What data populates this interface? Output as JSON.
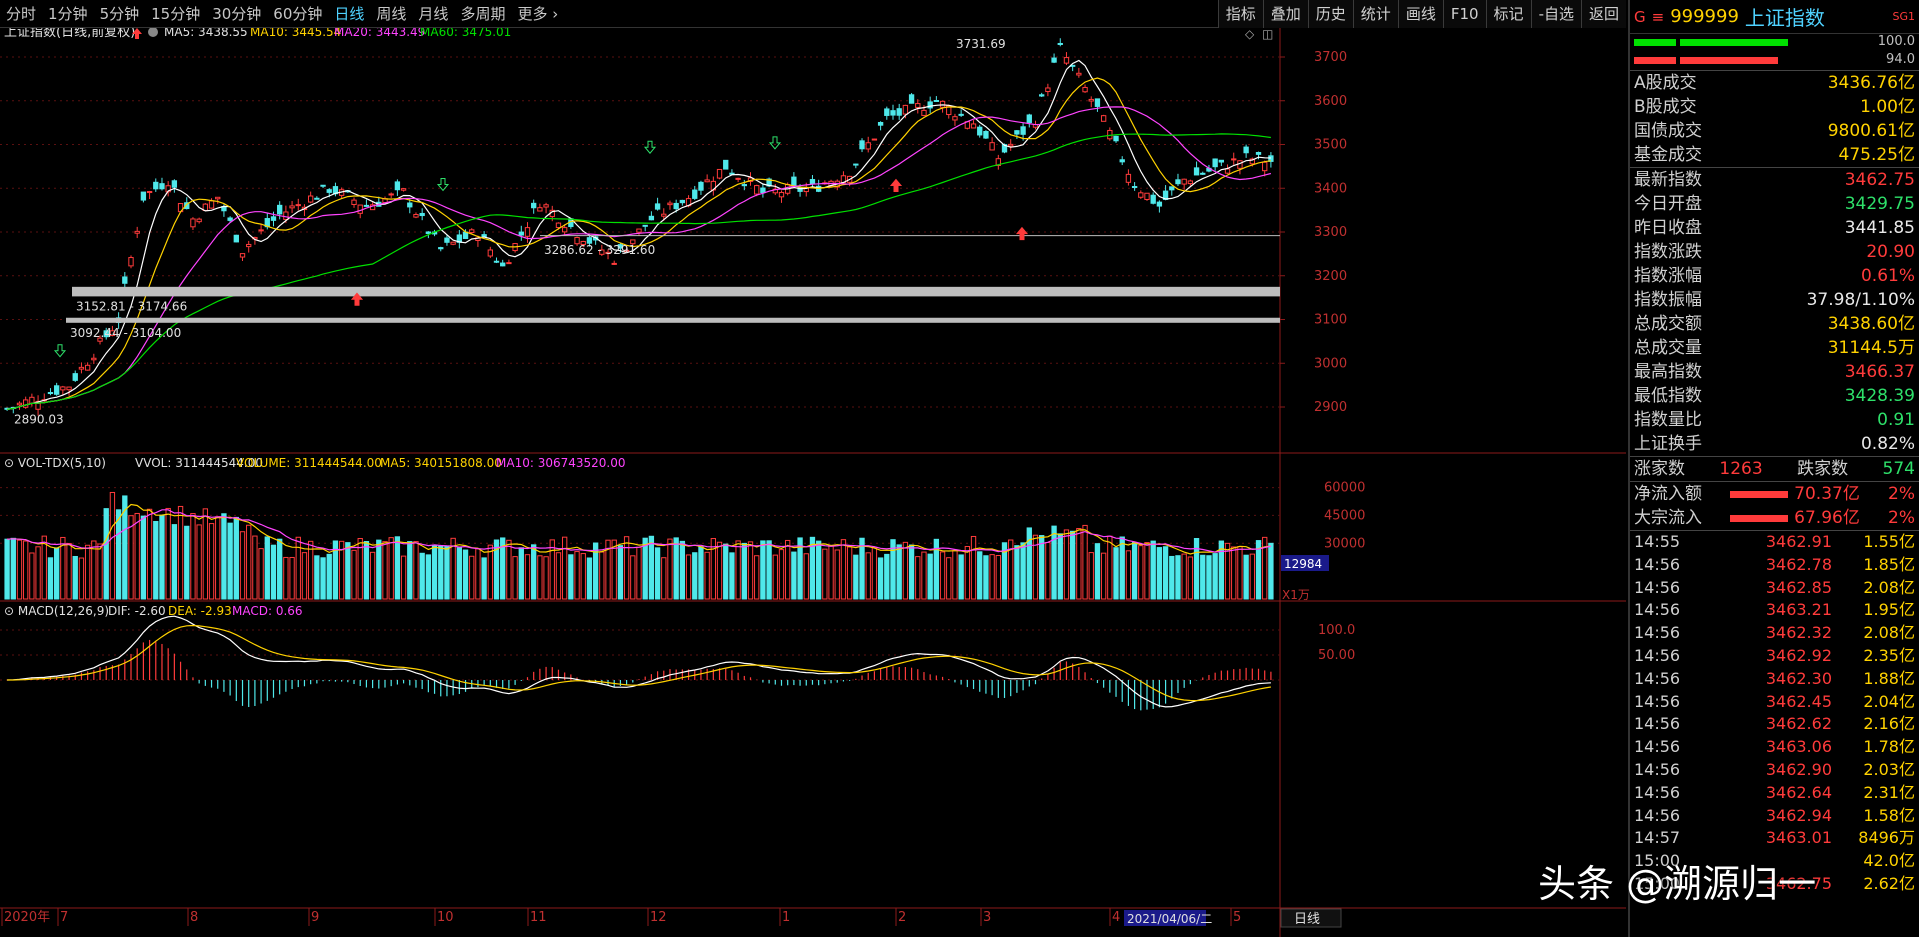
{
  "toolbar": {
    "periods": [
      "分时",
      "1分钟",
      "5分钟",
      "15分钟",
      "30分钟",
      "60分钟",
      "日线",
      "周线",
      "月线",
      "多周期",
      "更多"
    ],
    "active_period": "日线",
    "right_buttons": [
      "指标",
      "叠加",
      "历史",
      "统计",
      "画线",
      "F10",
      "标记",
      "-自选",
      "返回"
    ]
  },
  "main_chart": {
    "title": "上证指数(日线,前复权)",
    "ma5_label": "MA5: 3438.55",
    "ma10_label": "MA10: 3445.54",
    "ma20_label": "MA20: 3443.49",
    "ma60_label": "MA60: 3475.01",
    "high_label": "3731.69",
    "low_label": "2890.03",
    "zone1_label": "3152.81 - 3174.66",
    "zone2_label": "3092.44 - 3104.00",
    "zone3_label": "3286.62 - 3291.60",
    "y_ticks": [
      "3700",
      "3600",
      "3500",
      "3400",
      "3300",
      "3200",
      "3100",
      "3000",
      "2900"
    ]
  },
  "volume_chart": {
    "title": "VOL-TDX(5,10)",
    "vvol_label": "VVOL: 311444544.00",
    "volume_label": "VOLUME: 311444544.00",
    "ma5_label": "MA5: 340151808.00",
    "ma10_label": "MA10: 306743520.00",
    "y_ticks": [
      "60000",
      "45000",
      "30000"
    ],
    "cursor_value": "12984",
    "unit": "X1万"
  },
  "macd_chart": {
    "title": "MACD(12,26,9)",
    "dif_label": "DIF: -2.60",
    "dea_label": "DEA: -2.93",
    "macd_label": "MACD: 0.66",
    "y_ticks": [
      "100.0",
      "50.00"
    ]
  },
  "x_axis": {
    "labels": [
      "2020年",
      "7",
      "8",
      "9",
      "10",
      "11",
      "12",
      "1",
      "2",
      "3",
      "4",
      "5"
    ],
    "cursor_date": "2021/04/06/二",
    "period_button": "日线"
  },
  "panel": {
    "flag": "G",
    "menu_icon": "menu-icon",
    "code": "999999",
    "name": "上证指数",
    "tag": "SG1",
    "bar1_pct": "100.0",
    "bar2_pct": "94.0",
    "turnover": [
      {
        "label": "A股成交",
        "value": "3436.76亿"
      },
      {
        "label": "B股成交",
        "value": "1.00亿"
      },
      {
        "label": "国债成交",
        "value": "9800.61亿"
      },
      {
        "label": "基金成交",
        "value": "475.25亿"
      }
    ],
    "stats": [
      {
        "label": "最新指数",
        "value": "3462.75"
      },
      {
        "label": "今日开盘",
        "value": "3429.75"
      },
      {
        "label": "昨日收盘",
        "value": "3441.85"
      },
      {
        "label": "指数涨跌",
        "value": "20.90"
      },
      {
        "label": "指数涨幅",
        "value": "0.61%"
      },
      {
        "label": "指数振幅",
        "value": "37.98/1.10%"
      },
      {
        "label": "总成交额",
        "value": "3438.60亿"
      },
      {
        "label": "总成交量",
        "value": "31144.5万"
      },
      {
        "label": "最高指数",
        "value": "3466.37"
      },
      {
        "label": "最低指数",
        "value": "3428.39"
      },
      {
        "label": "指数量比",
        "value": "0.91"
      },
      {
        "label": "上证换手",
        "value": "0.82%"
      }
    ],
    "breadth": {
      "up_label": "涨家数",
      "up_value": "1263",
      "down_label": "跌家数",
      "down_value": "574"
    },
    "flows": [
      {
        "label": "净流入额",
        "value": "70.37亿",
        "pct": "2%"
      },
      {
        "label": "大宗流入",
        "value": "67.96亿",
        "pct": "2%"
      }
    ],
    "ticks": [
      {
        "time": "14:55",
        "price": "3462.91",
        "vol": "1.55亿"
      },
      {
        "time": "14:56",
        "price": "3462.78",
        "vol": "1.85亿"
      },
      {
        "time": "14:56",
        "price": "3462.85",
        "vol": "2.08亿"
      },
      {
        "time": "14:56",
        "price": "3463.21",
        "vol": "1.95亿"
      },
      {
        "time": "14:56",
        "price": "3462.32",
        "vol": "2.08亿"
      },
      {
        "time": "14:56",
        "price": "3462.92",
        "vol": "2.35亿"
      },
      {
        "time": "14:56",
        "price": "3462.30",
        "vol": "1.88亿"
      },
      {
        "time": "14:56",
        "price": "3462.45",
        "vol": "2.04亿"
      },
      {
        "time": "14:56",
        "price": "3462.62",
        "vol": "2.16亿"
      },
      {
        "time": "14:56",
        "price": "3463.06",
        "vol": "1.78亿"
      },
      {
        "time": "14:56",
        "price": "3462.90",
        "vol": "2.03亿"
      },
      {
        "time": "14:56",
        "price": "3462.64",
        "vol": "2.31亿"
      },
      {
        "time": "14:56",
        "price": "3462.94",
        "vol": "1.58亿"
      },
      {
        "time": "14:57",
        "price": "3463.01",
        "vol": "8496万"
      },
      {
        "time": "15:00",
        "price": "",
        "vol": "42.0亿"
      },
      {
        "time": "15:00",
        "price": "3462.75",
        "vol": "2.62亿"
      }
    ]
  },
  "watermark": "头条 @溯源归一",
  "colors": {
    "up": "#ff3b3b",
    "down": "#4fe8ea",
    "ma5": "#ffffff",
    "ma10": "#ffd200",
    "ma20": "#ff44ff",
    "ma60": "#00e000"
  }
}
